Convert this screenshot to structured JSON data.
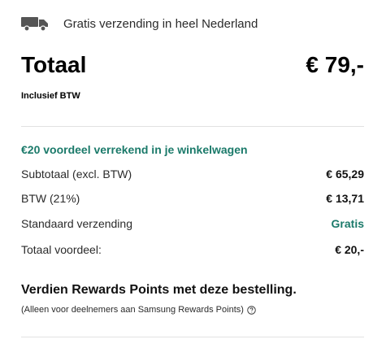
{
  "shipping": {
    "icon": "truck-icon",
    "text": "Gratis verzending in heel Nederland"
  },
  "total": {
    "label": "Totaal",
    "value": "€ 79,-",
    "tax_note": "Inclusief BTW"
  },
  "discount_note": "€20 voordeel verrekend in je winkelwagen",
  "line_items": [
    {
      "label": "Subtotaal (excl. BTW)",
      "value": "€ 65,29"
    },
    {
      "label": "BTW (21%)",
      "value": "€ 13,71"
    },
    {
      "label": "Standaard verzending",
      "value": "Gratis"
    },
    {
      "label": "Totaal voordeel:",
      "value": "€ 20,-"
    }
  ],
  "rewards": {
    "title": "Verdien Rewards Points met deze bestelling.",
    "subtitle": "(Alleen voor deelnemers aan Samsung Rewards Points)",
    "help_icon": "help-circle-icon"
  },
  "colors": {
    "accent_green": "#1b7a6a",
    "text": "#1a1a1a",
    "divider": "#e2e2e2",
    "truck_icon": "#555555"
  }
}
